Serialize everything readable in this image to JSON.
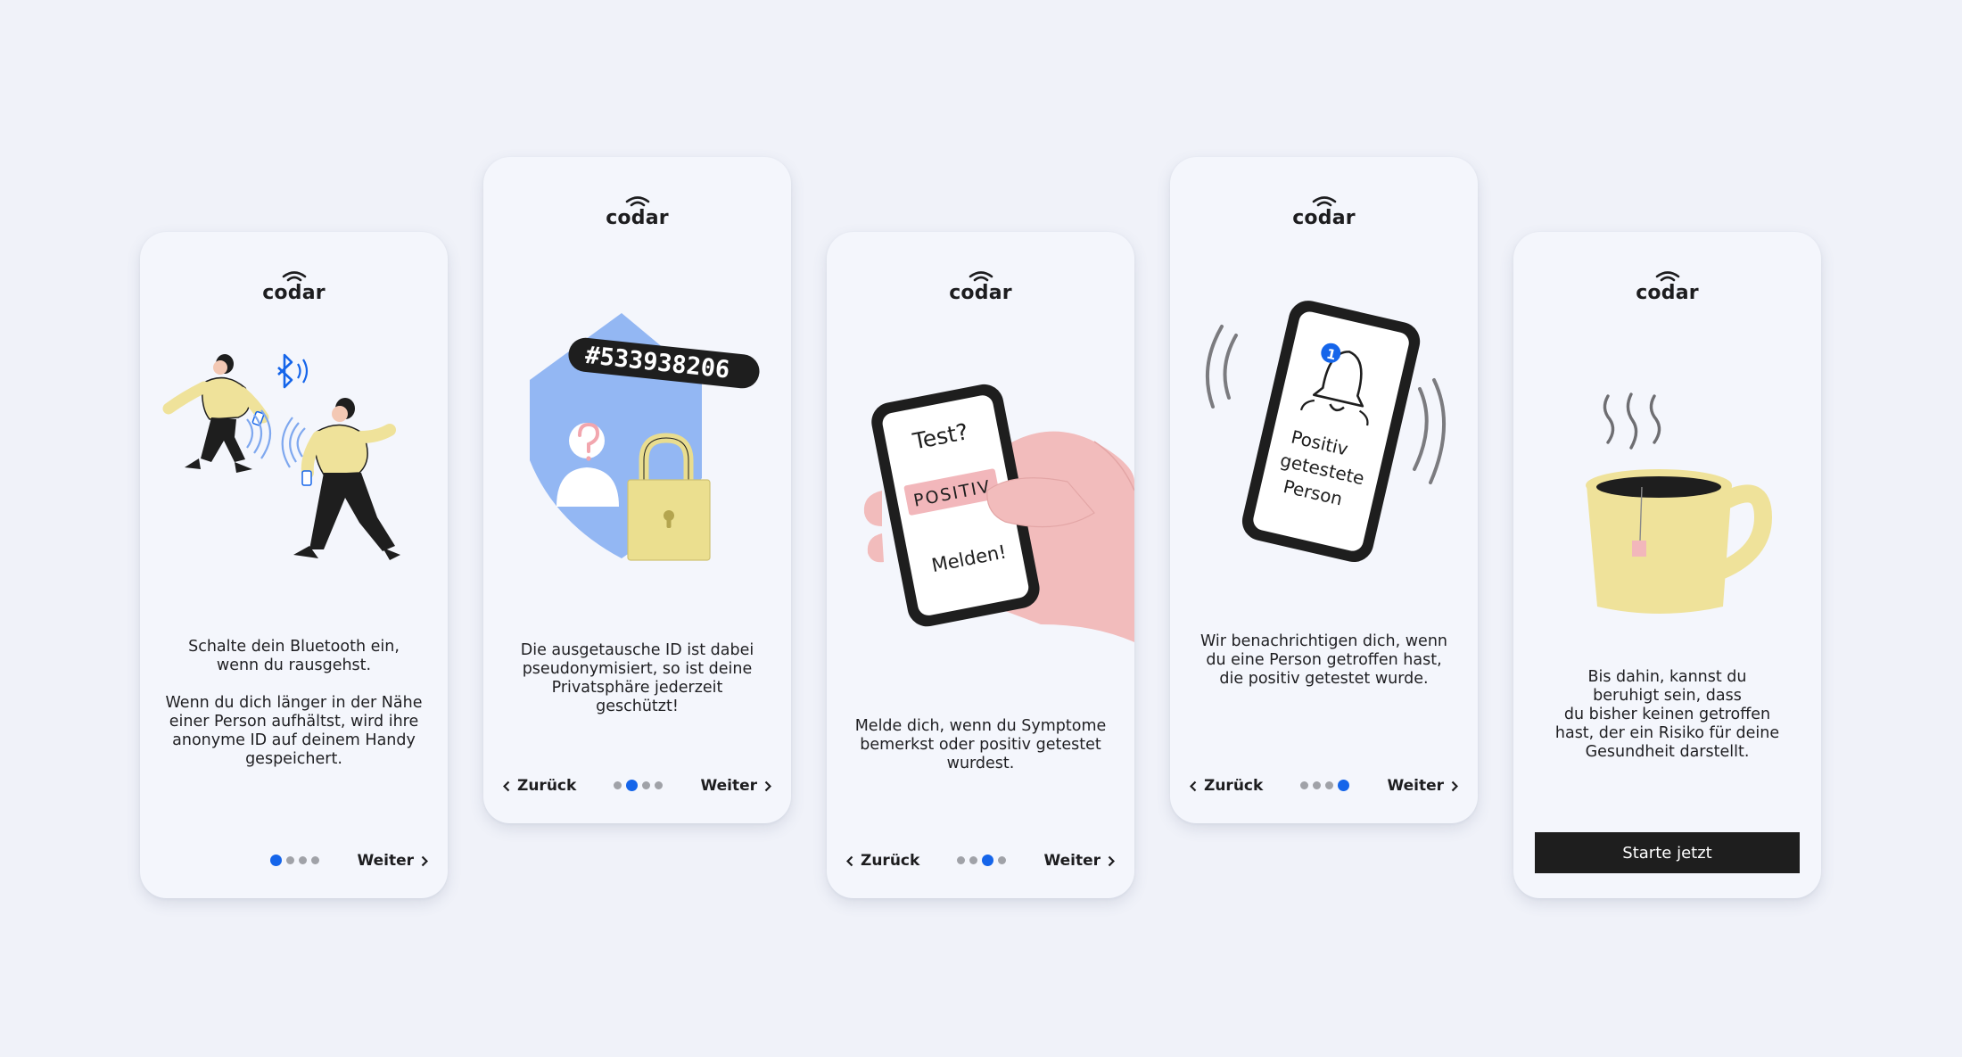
{
  "brand": "codar",
  "colors": {
    "background": "#f0f2f9",
    "card": "#f4f6fc",
    "accent": "#1565ea",
    "illustration_yellow": "#efe29a",
    "illustration_blue": "#93b7f3",
    "illustration_pink": "#f2bcbc"
  },
  "screens": [
    {
      "text": "Schalte dein Bluetooth ein,\nwenn du rausgehst.\n\nWenn du dich länger in der Nähe\neiner Person aufhältst, wird ihre\nanonyme ID auf deinem Handy\ngespeichert.",
      "next_label": "Weiter",
      "active_step": 1
    },
    {
      "id_number": "#533938206",
      "text": "Die ausgetausche ID ist dabei\npseudonymisiert, so ist deine\nPrivatsphäre jederzeit\ngeschützt!",
      "back_label": "Zurück",
      "next_label": "Weiter",
      "active_step": 2
    },
    {
      "phone_question": "Test?",
      "phone_result": "POSITIV",
      "phone_action": "Melden!",
      "text": "Melde dich, wenn du Symptome\nbemerkst oder positiv getestet\nwurdest.",
      "back_label": "Zurück",
      "next_label": "Weiter",
      "active_step": 3
    },
    {
      "notification_count": "1",
      "phone_message": [
        "Positiv",
        "getestete",
        "Person"
      ],
      "text": "Wir benachrichtigen dich, wenn\ndu eine Person getroffen hast,\ndie positiv getestet wurde.",
      "back_label": "Zurück",
      "next_label": "Weiter",
      "active_step": 4
    },
    {
      "text": "Bis dahin, kannst du\nberuhigt sein, dass\ndu bisher keinen getroffen\nhast, der ein Risiko für deine\nGesundheit darstellt.",
      "button_label": "Starte jetzt"
    }
  ],
  "icons": {
    "logo": "wifi-signal-icon",
    "back": "chevron-left-icon",
    "next": "chevron-right-icon",
    "bluetooth": "bluetooth-icon",
    "lock": "padlock-icon",
    "bell": "bell-icon"
  }
}
